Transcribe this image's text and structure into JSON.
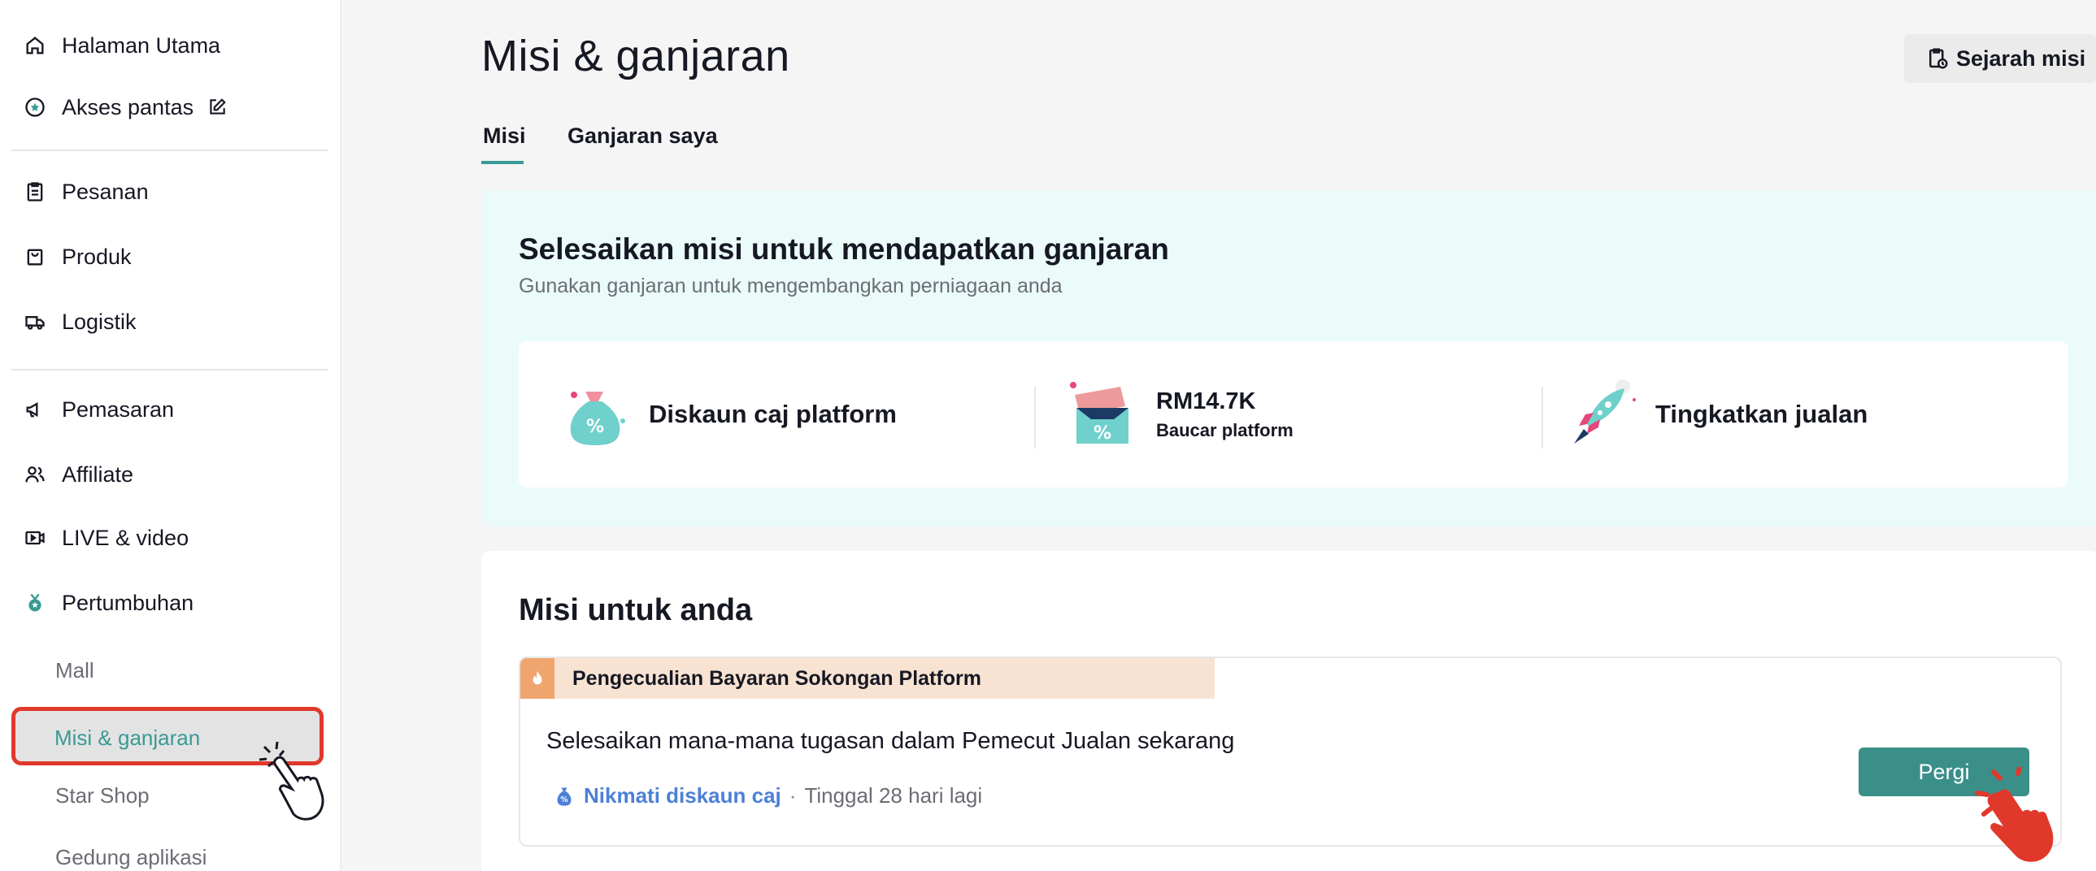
{
  "sidebar": {
    "items": [
      {
        "label": "Halaman Utama",
        "icon": "home-icon"
      },
      {
        "label": "Akses pantas",
        "icon": "star-circle-icon"
      },
      {
        "label": "Pesanan",
        "icon": "clipboard-icon"
      },
      {
        "label": "Produk",
        "icon": "bag-icon"
      },
      {
        "label": "Logistik",
        "icon": "truck-icon"
      },
      {
        "label": "Pemasaran",
        "icon": "megaphone-icon"
      },
      {
        "label": "Affiliate",
        "icon": "users-icon"
      },
      {
        "label": "LIVE & video",
        "icon": "video-icon"
      },
      {
        "label": "Pertumbuhan",
        "icon": "growth-medal-icon"
      }
    ],
    "sub_items": [
      "Mall",
      "Misi & ganjaran",
      "Star Shop",
      "Gedung aplikasi"
    ],
    "active_sub_item": "Misi & ganjaran"
  },
  "header": {
    "title": "Misi & ganjaran",
    "history_button": "Sejarah misi"
  },
  "tabs": [
    {
      "label": "Misi",
      "active": true
    },
    {
      "label": "Ganjaran saya",
      "active": false
    }
  ],
  "hero": {
    "title": "Selesaikan misi untuk mendapatkan ganjaran",
    "subtitle": "Gunakan ganjaran untuk mengembangkan perniagaan anda",
    "benefits": [
      {
        "label": "Diskaun caj platform",
        "icon": "money-bag-percent-icon"
      },
      {
        "value": "RM14.7K",
        "caption": "Baucar platform",
        "icon": "voucher-ticket-icon"
      },
      {
        "label": "Tingkatkan jualan",
        "icon": "rocket-icon"
      }
    ]
  },
  "missions": {
    "title": "Misi untuk anda",
    "cards": [
      {
        "tag": "Pengecualian Bayaran Sokongan Platform",
        "description": "Selesaikan mana-mana tugasan dalam Pemecut Jualan sekarang",
        "perk": "Nikmati diskaun caj",
        "separator": "·",
        "remaining": "Tinggal 28 hari lagi",
        "button": "Pergi"
      }
    ]
  },
  "colors": {
    "accent": "#3a9a94",
    "button": "#3a8f89",
    "hero_bg": "#eafbfa",
    "tag_bg": "#f8e3d3",
    "highlight_border": "#e0392b",
    "perk_link": "#4d80d6"
  }
}
